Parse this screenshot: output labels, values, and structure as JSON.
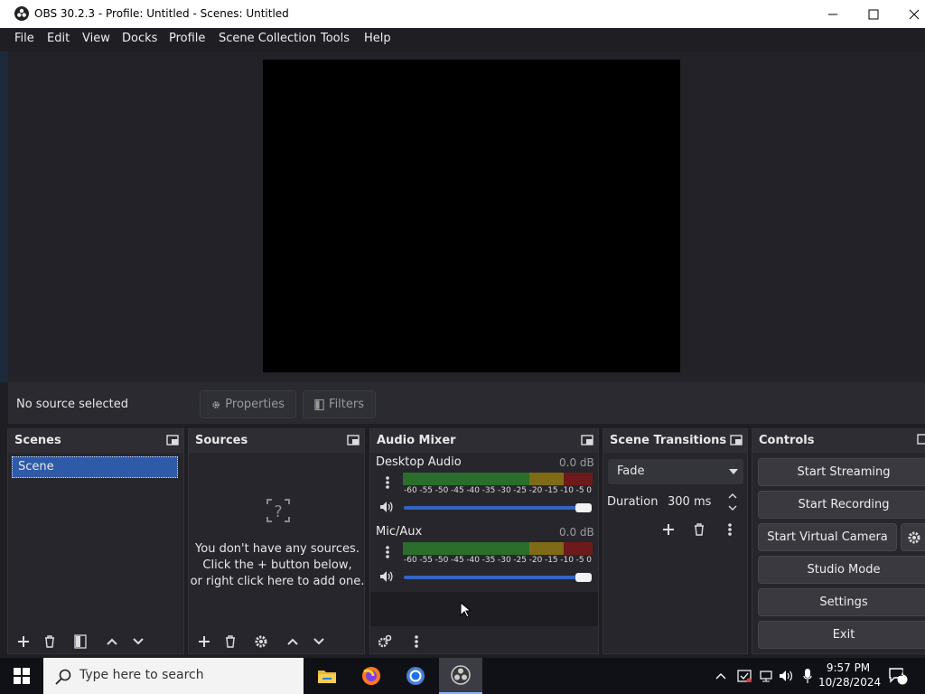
{
  "window": {
    "title": "OBS 30.2.3 - Profile: Untitled - Scenes: Untitled"
  },
  "menu": [
    "File",
    "Edit",
    "View",
    "Docks",
    "Profile",
    "Scene Collection",
    "Tools",
    "Help"
  ],
  "source_toolbar": {
    "status": "No source selected",
    "properties": "Properties",
    "filters": "Filters"
  },
  "docks": {
    "scenes": {
      "title": "Scenes",
      "items": [
        "Scene"
      ]
    },
    "sources": {
      "title": "Sources",
      "empty_line1": "You don't have any sources.",
      "empty_line2": "Click the + button below,",
      "empty_line3": "or right click here to add one."
    },
    "audio_mixer": {
      "title": "Audio Mixer",
      "channels": [
        {
          "name": "Desktop Audio",
          "db": "0.0 dB",
          "volume": 1.0
        },
        {
          "name": "Mic/Aux",
          "db": "0.0 dB",
          "volume": 1.0
        }
      ],
      "ticks": [
        "-60",
        "-55",
        "-50",
        "-45",
        "-40",
        "-35",
        "-30",
        "-25",
        "-20",
        "-15",
        "-10",
        "-5",
        "0"
      ]
    },
    "transitions": {
      "title": "Scene Transitions",
      "selected": "Fade",
      "duration_label": "Duration",
      "duration_value": "300 ms"
    },
    "controls": {
      "title": "Controls",
      "start_streaming": "Start Streaming",
      "start_recording": "Start Recording",
      "start_virtual_camera": "Start Virtual Camera",
      "studio_mode": "Studio Mode",
      "settings": "Settings",
      "exit": "Exit"
    }
  },
  "taskbar": {
    "search_placeholder": "Type here to search",
    "time": "9:57 PM",
    "date": "10/28/2024",
    "notifications": "2"
  }
}
